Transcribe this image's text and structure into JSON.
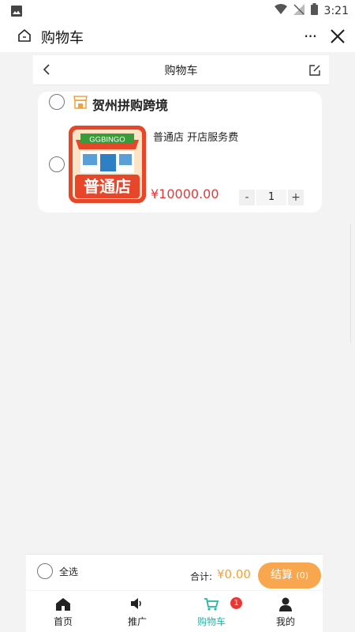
{
  "status_bar": {
    "time": "3:21"
  },
  "app_bar": {
    "title": "购物车",
    "more_label": "···"
  },
  "page_header": {
    "title": "购物车"
  },
  "cart": {
    "store_name": "贺州拼购跨境",
    "item": {
      "image_top_text": "GGBINGO",
      "image_main_text": "普通店",
      "title": "普通店 开店服务费",
      "price": "¥10000.00",
      "quantity": "1",
      "minus_label": "-",
      "plus_label": "+"
    }
  },
  "summary": {
    "select_all_label": "全选",
    "total_label": "合计:",
    "total_value": "¥0.00",
    "checkout_label": "结算",
    "checkout_count": "(0)"
  },
  "tabs": [
    {
      "label": "首页",
      "icon": "home-icon"
    },
    {
      "label": "推广",
      "icon": "speaker-icon"
    },
    {
      "label": "购物车",
      "icon": "cart-icon",
      "active": true,
      "badge": "1"
    },
    {
      "label": "我的",
      "icon": "user-icon"
    }
  ],
  "colors": {
    "accent_teal": "#26b5a5",
    "price_red": "#e23a3a",
    "checkout_orange": "#f9a74f",
    "total_orange": "#f0a23a",
    "badge_red": "#e53935"
  }
}
